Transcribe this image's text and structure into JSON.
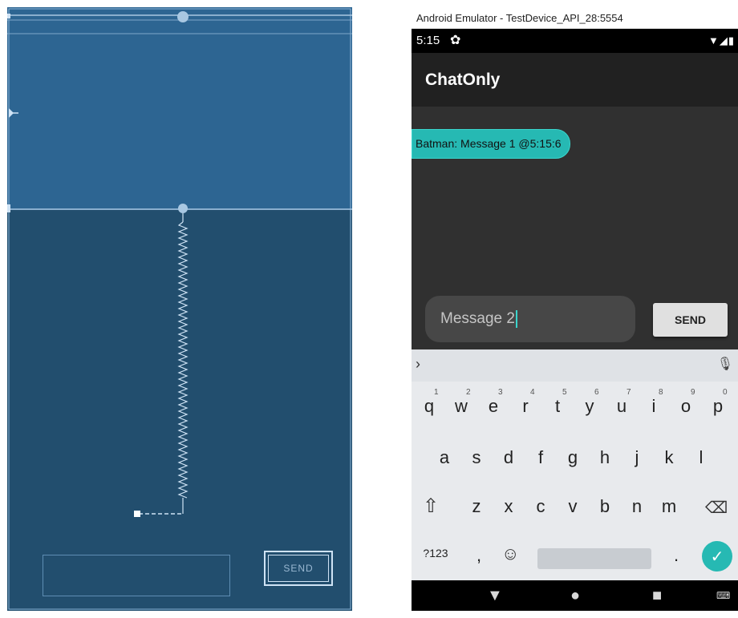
{
  "blueprint": {
    "send_label": "SEND"
  },
  "emulator": {
    "window_title": "Android Emulator - TestDevice_API_28:5554",
    "status_time": "5:15",
    "status_gear_icon": "gear-icon",
    "app_title": "ChatOnly",
    "messages": [
      "Batman: Message 1 @5:15:6"
    ],
    "input_value": "Message 2",
    "send_label": "SEND",
    "accent_color": "#26b9b3",
    "keyboard": {
      "row1": [
        "q",
        "w",
        "e",
        "r",
        "t",
        "y",
        "u",
        "i",
        "o",
        "p"
      ],
      "row1_hints": [
        "1",
        "2",
        "3",
        "4",
        "5",
        "6",
        "7",
        "8",
        "9",
        "0"
      ],
      "row2": [
        "a",
        "s",
        "d",
        "f",
        "g",
        "h",
        "j",
        "k",
        "l"
      ],
      "row3": [
        "z",
        "x",
        "c",
        "v",
        "b",
        "n",
        "m"
      ],
      "symbols_label": "?123",
      "comma": ",",
      "period": "."
    }
  }
}
